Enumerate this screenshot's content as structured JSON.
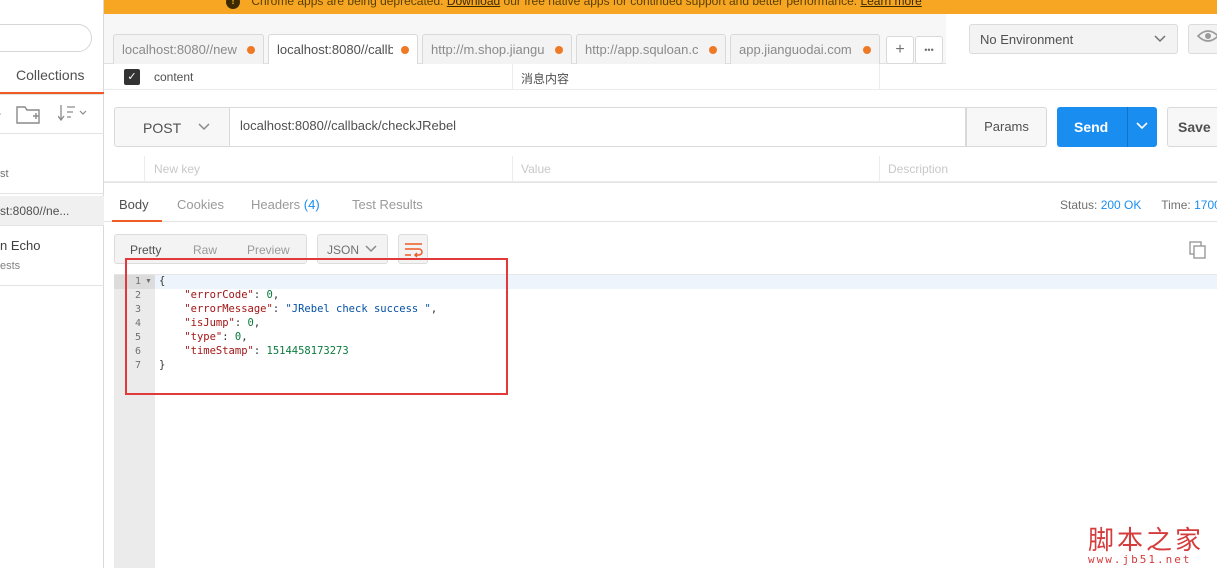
{
  "banner": {
    "text": "Chrome apps are being deprecated.",
    "download_link": "Download",
    "rest": "our free native apps for continued support and better performance.",
    "learn_more": "Learn more"
  },
  "sidebar": {
    "collections_tab": "Collections",
    "history_item": "st",
    "active_request": "st:8080//ne...",
    "collection_name": "n Echo",
    "collection_sub": "ests"
  },
  "tabs": [
    {
      "label": "localhost:8080//new"
    },
    {
      "label": "localhost:8080//callb"
    },
    {
      "label": "http://m.shop.jiangu"
    },
    {
      "label": "http://app.squloan.c"
    },
    {
      "label": "app.jianguodai.com"
    }
  ],
  "tab_buttons": {
    "add": "+",
    "more": "•••"
  },
  "environment": {
    "selected": "No Environment"
  },
  "params_top": {
    "key": "content",
    "value": "消息内容"
  },
  "params_new": {
    "key_ph": "New key",
    "value_ph": "Value",
    "desc_ph": "Description"
  },
  "request": {
    "method": "POST",
    "url": "localhost:8080//callback/checkJRebel",
    "params_label": "Params",
    "send_label": "Send",
    "save_label": "Save"
  },
  "response_tabs": {
    "body": "Body",
    "cookies": "Cookies",
    "headers": "Headers",
    "headers_count": "(4)",
    "tests": "Test Results"
  },
  "status": {
    "label": "Status:",
    "value": "200 OK",
    "time_label": "Time:",
    "time_value": "1700"
  },
  "view": {
    "pretty": "Pretty",
    "raw": "Raw",
    "preview": "Preview",
    "format": "JSON"
  },
  "code_lines": [
    {
      "num": "1",
      "text": "{"
    },
    {
      "num": "2",
      "key": "\"errorCode\"",
      "val": "0",
      "type": "n",
      "comma": ","
    },
    {
      "num": "3",
      "key": "\"errorMessage\"",
      "val": "\"JRebel check success \"",
      "type": "s",
      "comma": ","
    },
    {
      "num": "4",
      "key": "\"isJump\"",
      "val": "0",
      "type": "n",
      "comma": ","
    },
    {
      "num": "5",
      "key": "\"type\"",
      "val": "0",
      "type": "n",
      "comma": ","
    },
    {
      "num": "6",
      "key": "\"timeStamp\"",
      "val": "1514458173273",
      "type": "n",
      "comma": ""
    },
    {
      "num": "7",
      "text": "}"
    }
  ],
  "watermark": {
    "top": "脚本之家",
    "bottom": "www.jb51.net"
  },
  "colors": {
    "accent": "#ef5b25",
    "send": "#1a8ef0",
    "banner": "#f6a623",
    "annotation": "#e23a3a"
  }
}
